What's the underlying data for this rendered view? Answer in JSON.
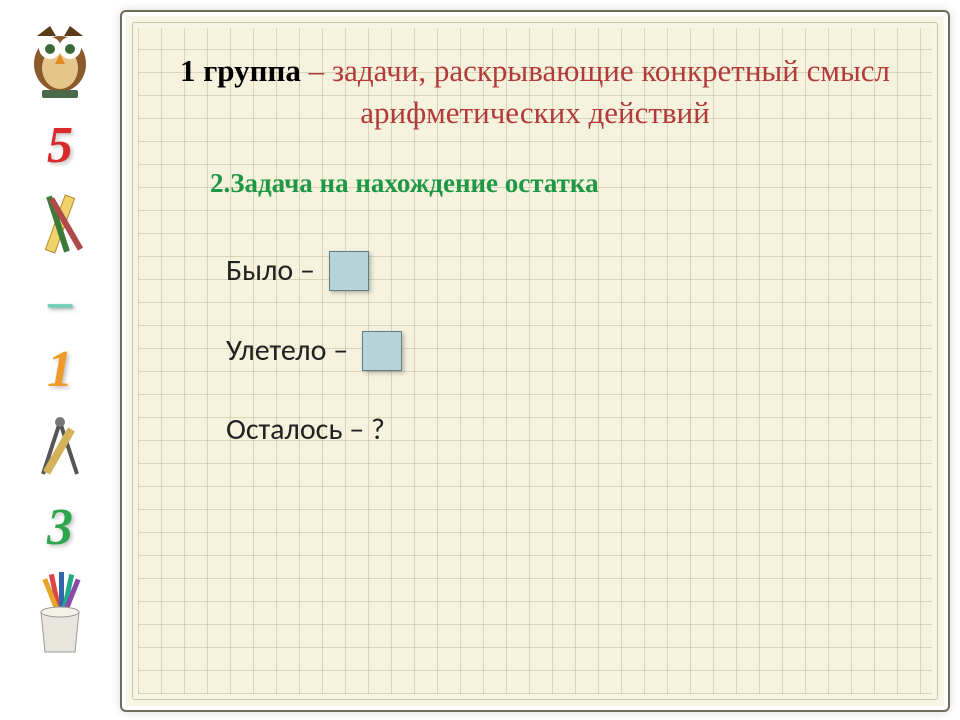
{
  "sidebar": {
    "digits": [
      "5",
      "–",
      "1",
      "3"
    ],
    "icons": [
      "owl",
      "ruler-pencils",
      "compass-tools",
      "pencil-cup"
    ]
  },
  "title": {
    "lead": "1 группа",
    "rest": " – задачи, раскрывающие конкретный смысл арифметических действий"
  },
  "subtitle": "2.Задача на нахождение остатка",
  "rows": {
    "r1": "Было –",
    "r2": "Улетело –",
    "r3": "Осталось – ?"
  }
}
